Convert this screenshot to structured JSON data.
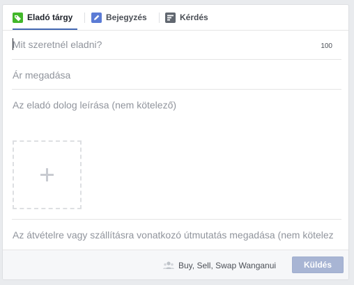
{
  "tabs": [
    {
      "label": "Eladó tárgy",
      "icon": "price-tag-icon",
      "active": true
    },
    {
      "label": "Bejegyzés",
      "icon": "pencil-icon",
      "active": false
    },
    {
      "label": "Kérdés",
      "icon": "poll-icon",
      "active": false
    }
  ],
  "form": {
    "title_placeholder": "Mit szeretnél eladni?",
    "title_char_limit": "100",
    "price_placeholder": "Ár megadása",
    "description_placeholder": "Az eladó dolog leírása (nem kötelező)",
    "location_placeholder": "Az átvételre vagy szállításra vonatkozó útmutatás megadása (nem kötelez"
  },
  "footer": {
    "group_name": "Buy, Sell, Swap Wanganui",
    "group_icon": "group-icon",
    "send_label": "Küldés"
  },
  "colors": {
    "accent": "#4267b2",
    "button_disabled": "#a8b5d4",
    "tag_green": "#42b72a"
  }
}
